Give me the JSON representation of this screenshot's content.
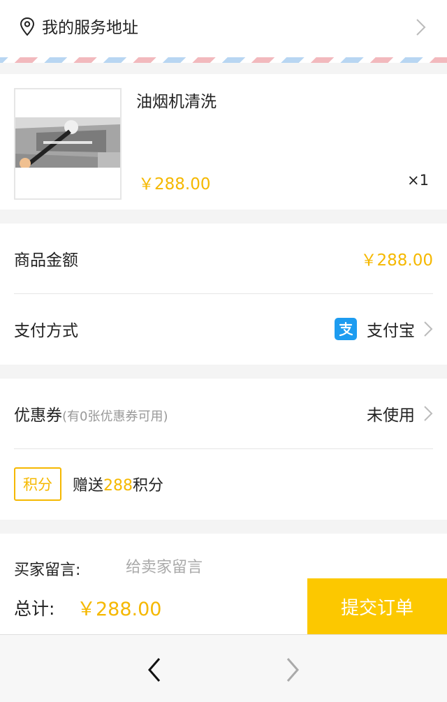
{
  "address": {
    "label": "我的服务地址"
  },
  "product": {
    "title": "油烟机清洗",
    "price": "￥288.00",
    "quantity": "×1"
  },
  "summary": {
    "amount_label": "商品金额",
    "amount_value": "￥288.00",
    "payment_label": "支付方式",
    "payment_value": "支付宝"
  },
  "coupon": {
    "label": "优惠券",
    "note": "(有0张优惠券可用)",
    "value": "未使用"
  },
  "points": {
    "badge": "积分",
    "prefix": "赠送",
    "amount": "288",
    "suffix": "积分"
  },
  "message": {
    "label": "买家留言:",
    "placeholder": "给卖家留言"
  },
  "footer": {
    "total_label": "总计:",
    "total_value": "￥288.00",
    "submit_label": "提交订单"
  },
  "colors": {
    "accent": "#f5b800",
    "submit": "#fcc800",
    "alipay": "#1d9cf0"
  },
  "icons": [
    "location-pin-icon",
    "chevron-right-icon",
    "alipay-icon",
    "back-arrow-icon",
    "forward-arrow-icon"
  ]
}
